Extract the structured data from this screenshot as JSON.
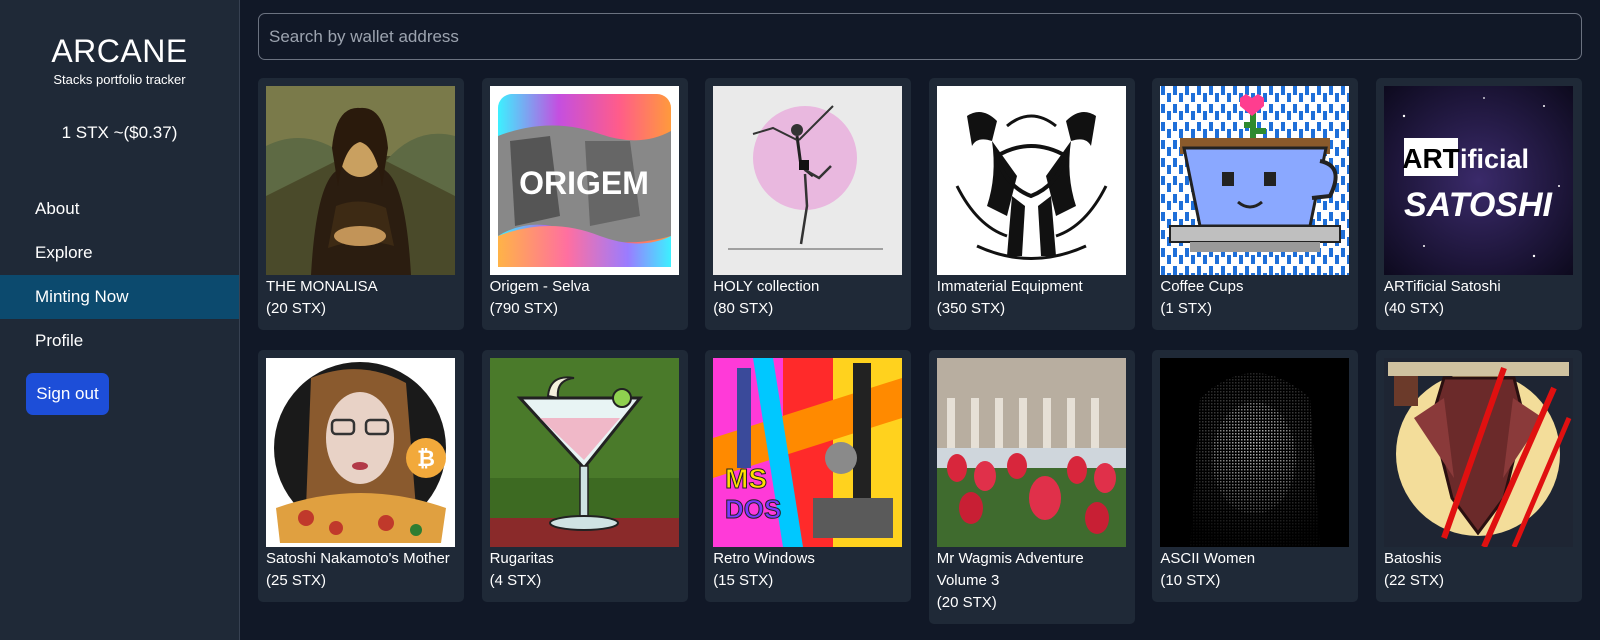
{
  "brand": {
    "title": "ARCANE",
    "subtitle": "Stacks portfolio tracker"
  },
  "price_label": "1 STX ~($0.37)",
  "nav": {
    "items": [
      {
        "label": "About"
      },
      {
        "label": "Explore"
      },
      {
        "label": "Minting Now"
      },
      {
        "label": "Profile"
      }
    ],
    "active": "Minting Now"
  },
  "signout_label": "Sign out",
  "search": {
    "placeholder": "Search by wallet address",
    "value": ""
  },
  "cards": [
    {
      "name": "THE MONALISA",
      "price": "(20 STX)",
      "image": "monalisa-painting"
    },
    {
      "name": "Origem - Selva",
      "price": "(790 STX)",
      "image": "origem-gradient",
      "image_text": "ORIGEM"
    },
    {
      "name": "HOLY collection",
      "price": "(80 STX)",
      "image": "dancer-sketch"
    },
    {
      "name": "Immaterial Equipment",
      "price": "(350 STX)",
      "image": "celtic-knot-horses"
    },
    {
      "name": "Coffee Cups",
      "price": "(1 STX)",
      "image": "pixel-coffee-cup"
    },
    {
      "name": "ARTificial Satoshi",
      "price": "(40 STX)",
      "image": "artificial-satoshi-logo",
      "image_text_1": "ART",
      "image_text_2": "ificial",
      "image_text_3": "SATOSHI"
    },
    {
      "name": "Satoshi Nakamoto's Mother",
      "price": "(25 STX)",
      "image": "satoshi-mother-portrait"
    },
    {
      "name": "Rugaritas",
      "price": "(4 STX)",
      "image": "pixel-martini"
    },
    {
      "name": "Retro Windows",
      "price": "(15 STX)",
      "image": "retro-windows-collage",
      "image_text_1": "MS",
      "image_text_2": "DOS"
    },
    {
      "name": "Mr Wagmis Adventure Volume 3",
      "price": "(20 STX)",
      "image": "tulips-building-photo"
    },
    {
      "name": "ASCII Women",
      "price": "(10 STX)",
      "image": "ascii-portrait"
    },
    {
      "name": "Batoshis",
      "price": "(22 STX)",
      "image": "pixel-bat-moon"
    }
  ]
}
